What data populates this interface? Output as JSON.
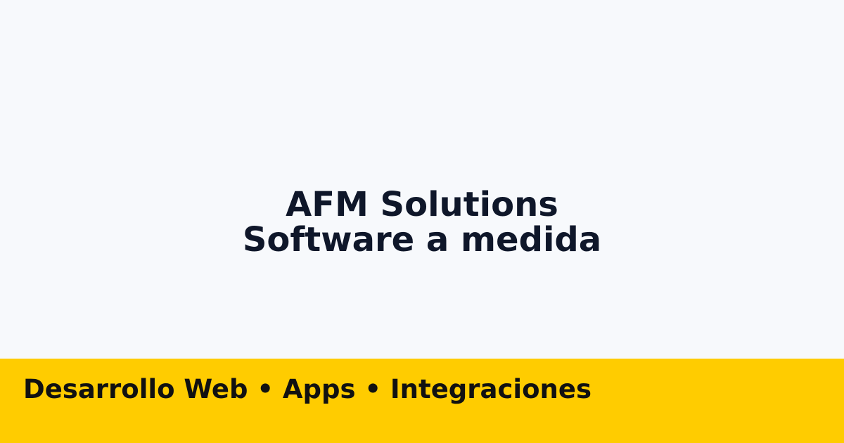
{
  "colors": {
    "background": "#f7f9fc",
    "title_text": "#0f172a",
    "banner_background": "#ffcc00",
    "banner_text": "#111111"
  },
  "hero": {
    "title": "AFM Solutions",
    "subtitle": "Software a medida"
  },
  "banner": {
    "text": "Desarrollo Web • Apps • Integraciones"
  }
}
